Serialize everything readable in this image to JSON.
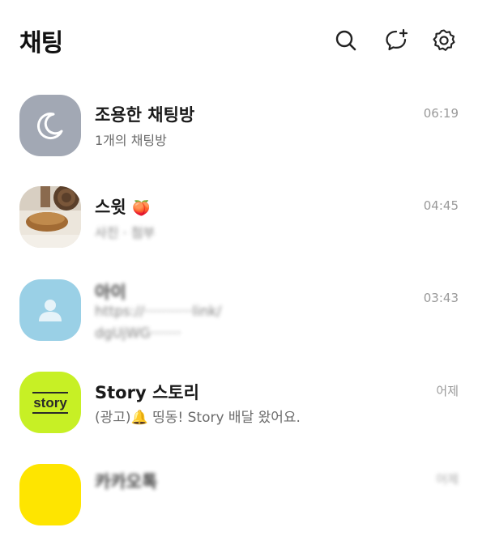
{
  "header": {
    "title": "채팅",
    "icons": [
      "search-icon",
      "new-chat-icon",
      "settings-icon"
    ]
  },
  "chats": [
    {
      "name": "조용한 채팅방",
      "preview": "1개의 채팅방",
      "time": "06:19",
      "avatar": "moon-icon",
      "avatar_color": "#a2a8b4"
    },
    {
      "name": "스윗",
      "preview": "사진 · 첨부",
      "time": "04:45",
      "avatar": "photo",
      "emoji": "🍑"
    },
    {
      "name": "아이",
      "preview_lines": [
        "https://···········link/",
        "dgUjWG·······"
      ],
      "time": "03:43",
      "avatar": "person-icon",
      "avatar_color": "#9ad0e6"
    },
    {
      "name": "Story 스토리",
      "preview": "(광고)🔔 띵동! Story 배달 왔어요.",
      "time": "어제",
      "avatar": "story-logo",
      "avatar_label": "story",
      "avatar_color": "#c7f025"
    },
    {
      "name": "카카오톡",
      "time": "어제",
      "avatar_color": "#fee500"
    }
  ]
}
